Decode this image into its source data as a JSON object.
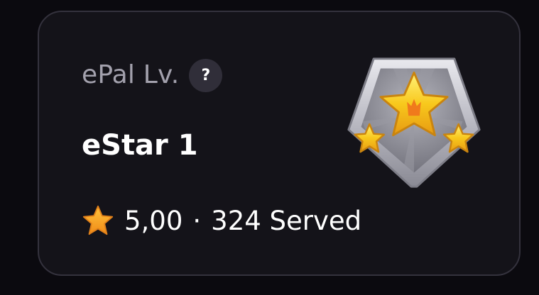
{
  "card": {
    "level_label": "ePal Lv.",
    "help_icon_glyph": "?",
    "level_name": "eStar 1",
    "rating": "5,00",
    "separator": "·",
    "served_text": "324 Served",
    "badge_icon": "estar-level-badge-icon",
    "rating_icon": "star-icon"
  },
  "colors": {
    "background": "#0b0a0f",
    "card_background": "#141319",
    "card_border": "#34323d",
    "muted_text": "#a3a1ad",
    "text": "#ffffff",
    "star_orange": "#f39a1f",
    "badge_gold": "#f6c21a"
  }
}
